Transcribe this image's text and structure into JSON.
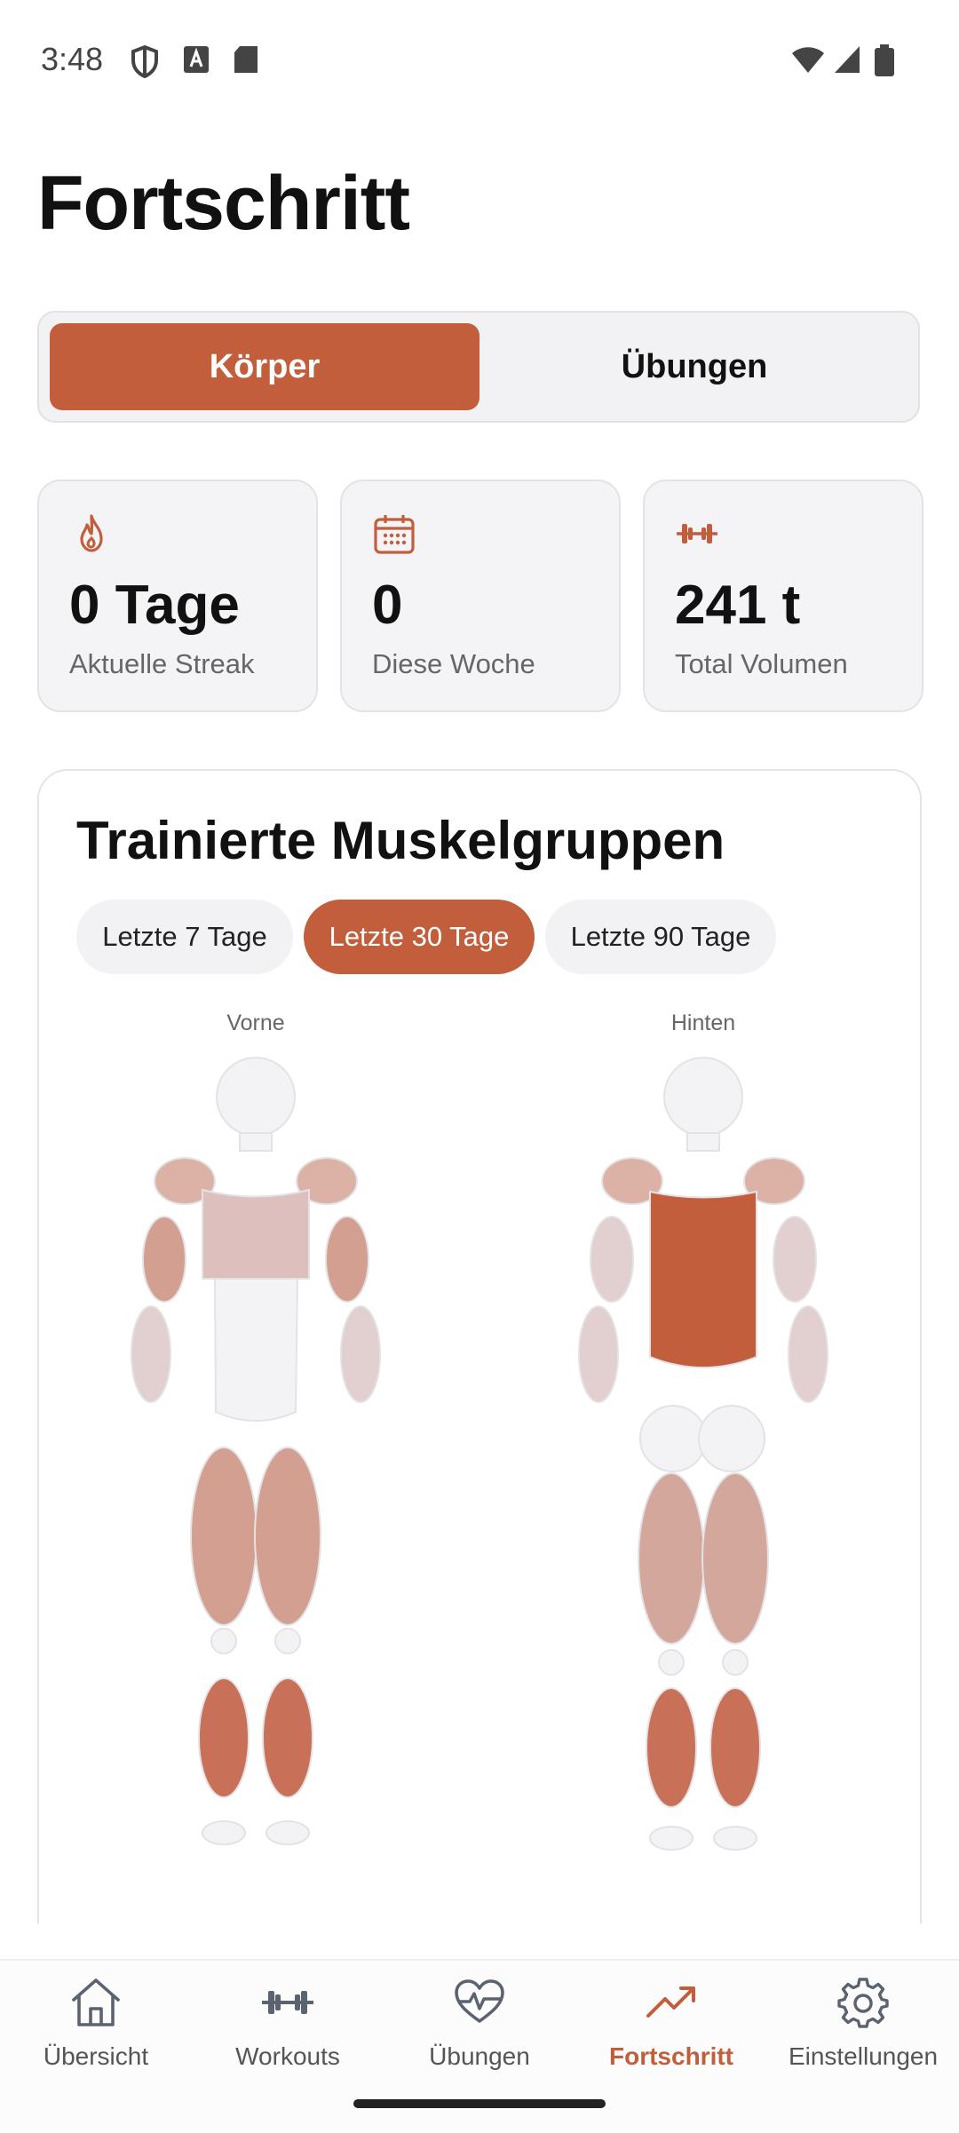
{
  "status_bar": {
    "time": "3:48"
  },
  "header": {
    "title": "Fortschritt"
  },
  "segment": {
    "options": [
      "Körper",
      "Übungen"
    ],
    "selected": "Körper"
  },
  "stats": [
    {
      "icon": "flame-icon",
      "value": "0 Tage",
      "label": "Aktuelle Streak"
    },
    {
      "icon": "calendar-icon",
      "value": "0",
      "label": "Diese Woche"
    },
    {
      "icon": "dumbbell-icon",
      "value": "241 t",
      "label": "Total Volumen"
    }
  ],
  "muscles": {
    "title": "Trainierte Muskelgruppen",
    "ranges": [
      "Letzte 7 Tage",
      "Letzte 30 Tage",
      "Letzte 90 Tage"
    ],
    "selected_range": "Letzte 30 Tage",
    "front_label": "Vorne",
    "back_label": "Hinten"
  },
  "nav": {
    "items": [
      {
        "label": "Übersicht",
        "icon": "home-icon"
      },
      {
        "label": "Workouts",
        "icon": "dumbbell-icon"
      },
      {
        "label": "Übungen",
        "icon": "heart-pulse-icon"
      },
      {
        "label": "Fortschritt",
        "icon": "trending-up-icon"
      },
      {
        "label": "Einstellungen",
        "icon": "gear-icon"
      }
    ],
    "active": "Fortschritt"
  },
  "colors": {
    "accent": "#c25e3b",
    "muscle_light": "#ddc0bd",
    "muscle_medium": "#d29f90",
    "muscle_strong": "#c87158",
    "muscle_none": "#f3f3f5"
  }
}
